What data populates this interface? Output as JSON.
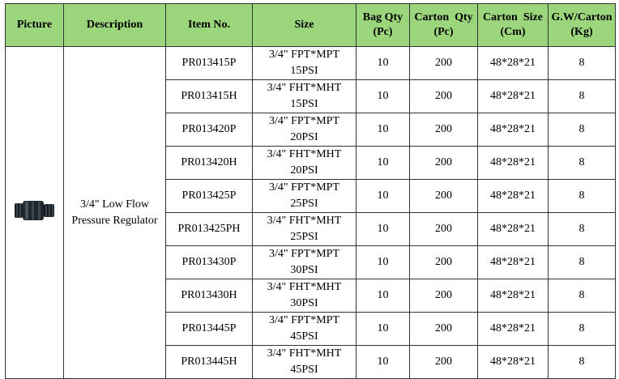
{
  "headers": {
    "picture": "Picture",
    "description": "Description",
    "item_no": "Item No.",
    "size": "Size",
    "bag_qty_1": "Bag Qty",
    "bag_qty_2": "(Pc)",
    "carton_qty_1": "Carton  Qty",
    "carton_qty_2": "(Pc)",
    "carton_size_1": "Carton  Size",
    "carton_size_2": "(Cm)",
    "gw_1": "G.W/Carton",
    "gw_2": "(Kg)"
  },
  "product": {
    "picture_icon": "pressure-regulator-fitting-image",
    "description_line1": "3/4\" Low Flow",
    "description_line2": "Pressure Regulator"
  },
  "colors": {
    "header_bg": "#9bd67c",
    "border": "#333333"
  },
  "rows": [
    {
      "item": "PR013415P",
      "size1": "3/4\" FPT*MPT",
      "size2": "15PSI",
      "bag_qty": "10",
      "carton_qty": "200",
      "carton_size": "48*28*21",
      "gw": "8"
    },
    {
      "item": "PR013415H",
      "size1": "3/4\" FHT*MHT",
      "size2": "15PSI",
      "bag_qty": "10",
      "carton_qty": "200",
      "carton_size": "48*28*21",
      "gw": "8"
    },
    {
      "item": "PR013420P",
      "size1": "3/4\" FPT*MPT",
      "size2": "20PSI",
      "bag_qty": "10",
      "carton_qty": "200",
      "carton_size": "48*28*21",
      "gw": "8"
    },
    {
      "item": "PR013420H",
      "size1": "3/4\" FHT*MHT",
      "size2": "20PSI",
      "bag_qty": "10",
      "carton_qty": "200",
      "carton_size": "48*28*21",
      "gw": "8"
    },
    {
      "item": "PR013425P",
      "size1": "3/4\" FPT*MPT",
      "size2": "25PSI",
      "bag_qty": "10",
      "carton_qty": "200",
      "carton_size": "48*28*21",
      "gw": "8"
    },
    {
      "item": "PR013425PH",
      "size1": "3/4\" FHT*MHT",
      "size2": "25PSI",
      "bag_qty": "10",
      "carton_qty": "200",
      "carton_size": "48*28*21",
      "gw": "8"
    },
    {
      "item": "PR013430P",
      "size1": "3/4\" FPT*MPT",
      "size2": "30PSI",
      "bag_qty": "10",
      "carton_qty": "200",
      "carton_size": "48*28*21",
      "gw": "8"
    },
    {
      "item": "PR013430H",
      "size1": "3/4\" FHT*MHT",
      "size2": "30PSI",
      "bag_qty": "10",
      "carton_qty": "200",
      "carton_size": "48*28*21",
      "gw": "8"
    },
    {
      "item": "PR013445P",
      "size1": "3/4\" FPT*MPT",
      "size2": "45PSI",
      "bag_qty": "10",
      "carton_qty": "200",
      "carton_size": "48*28*21",
      "gw": "8"
    },
    {
      "item": "PR013445H",
      "size1": "3/4\" FHT*MHT",
      "size2": "45PSI",
      "bag_qty": "10",
      "carton_qty": "200",
      "carton_size": "48*28*21",
      "gw": "8"
    }
  ]
}
